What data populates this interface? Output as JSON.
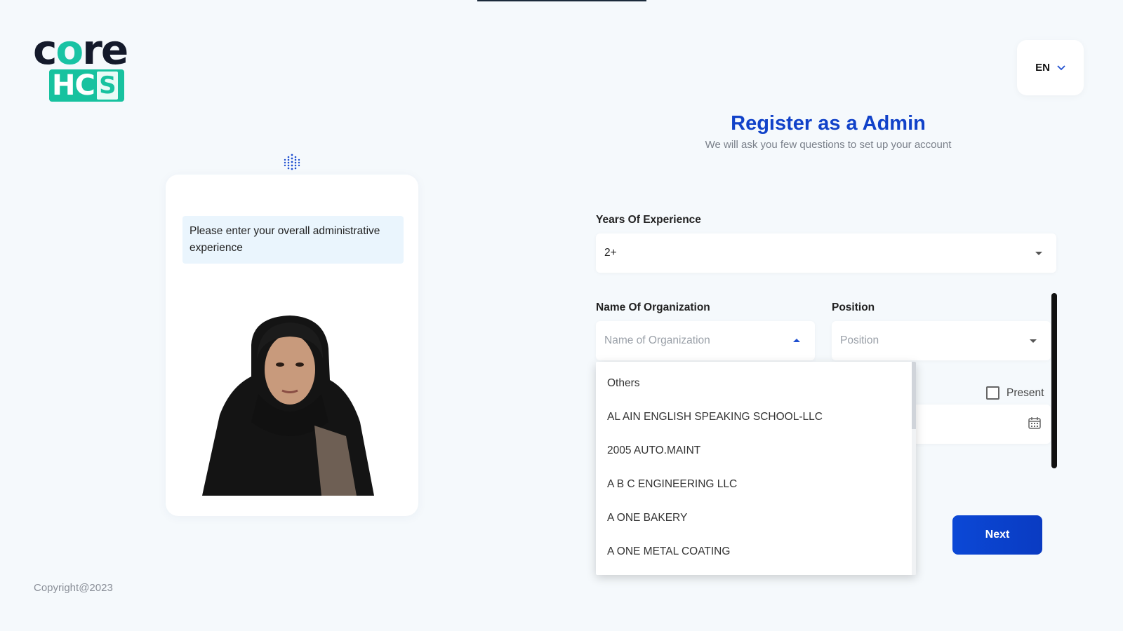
{
  "brand": {
    "logo_word": "core",
    "logo_badge": "HCS"
  },
  "language": {
    "selected": "EN"
  },
  "header": {
    "title": "Register as a Admin",
    "subtitle": "We will ask you few questions to set up your account"
  },
  "assistant": {
    "prompt": "Please enter your overall administrative experience"
  },
  "form": {
    "experience": {
      "label": "Years Of Experience",
      "value": "2+"
    },
    "organization": {
      "label": "Name Of Organization",
      "placeholder": "Name of Organization"
    },
    "position": {
      "label": "Position",
      "placeholder": "Position"
    },
    "present_label": "Present",
    "next_label": "Next"
  },
  "organization_options": [
    "Others",
    "AL AIN ENGLISH SPEAKING SCHOOL-LLC",
    "2005 AUTO.MAINT",
    "A B C ENGINEERING LLC",
    "A ONE BAKERY",
    "A ONE METAL COATING"
  ],
  "footer": {
    "copyright": "Copyright@2023"
  },
  "colors": {
    "primary": "#1142c9",
    "accent": "#17c29f",
    "background": "#f5f9fc"
  },
  "icons": [
    "chevron-down-icon",
    "dots-assistant-icon",
    "calendar-icon",
    "caret-down-icon",
    "caret-up-icon"
  ]
}
